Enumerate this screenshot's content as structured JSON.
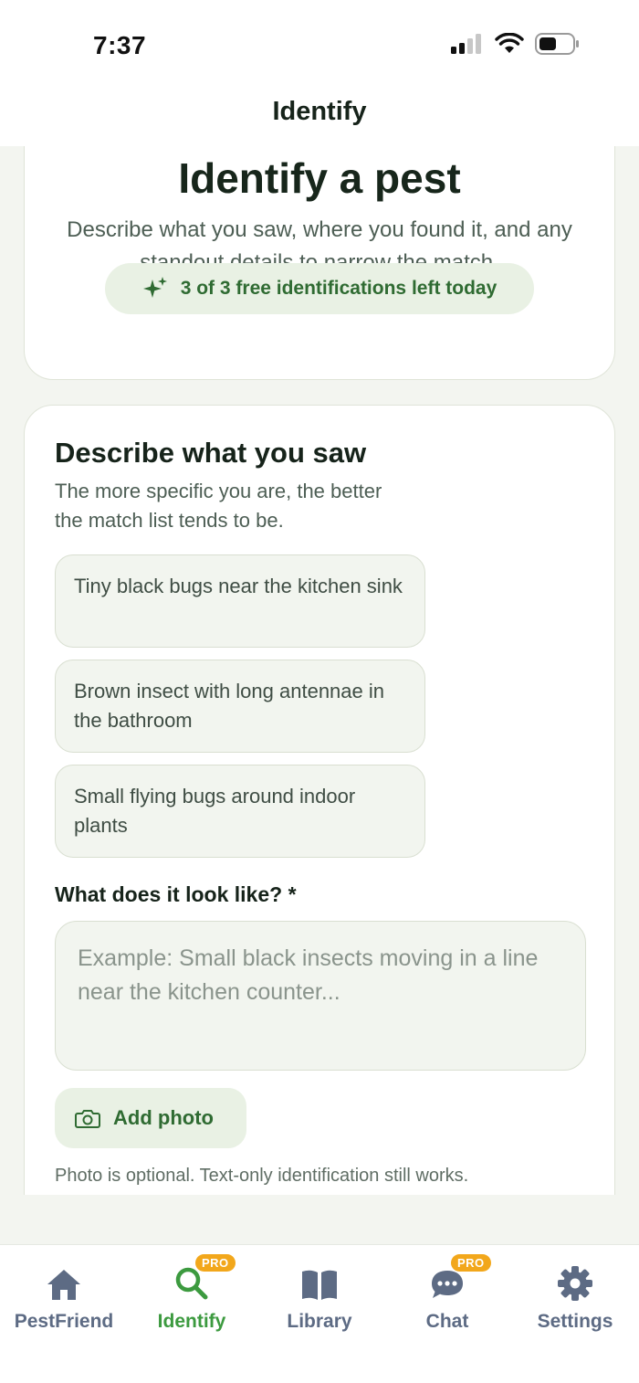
{
  "status_bar": {
    "time": "7:37"
  },
  "header": {
    "title": "Identify"
  },
  "hero": {
    "title": "Identify a pest",
    "subtitle": "Describe what you saw, where you found it, and any standout details to narrow the match.",
    "quota": "3 of 3 free identifications left today"
  },
  "form": {
    "title": "Describe what you saw",
    "subtitle": "The more specific you are, the better the match list tends to be.",
    "suggestions": [
      "Tiny black bugs near the kitchen sink",
      "Brown insect with long antennae in the bathroom",
      "Small flying bugs around indoor plants"
    ],
    "field_label": "What does it look like? *",
    "field_placeholder": "Example: Small black insects moving in a line near the kitchen counter...",
    "field_value": "",
    "add_photo_label": "Add photo",
    "photo_note": "Photo is optional. Text-only identification still works."
  },
  "tabbar": {
    "tabs": [
      {
        "label": "PestFriend",
        "icon": "house-icon"
      },
      {
        "label": "Identify",
        "icon": "search-icon",
        "badge": "PRO"
      },
      {
        "label": "Library",
        "icon": "book-icon"
      },
      {
        "label": "Chat",
        "icon": "chat-bubble-icon",
        "badge": "PRO"
      },
      {
        "label": "Settings",
        "icon": "gear-icon"
      }
    ],
    "active_tab": "Identify"
  },
  "colors": {
    "accent_green": "#3c9a3f",
    "dark_green": "#2f6b32",
    "pro_badge": "#f2a71b",
    "inactive_tab": "#5d6b84"
  }
}
